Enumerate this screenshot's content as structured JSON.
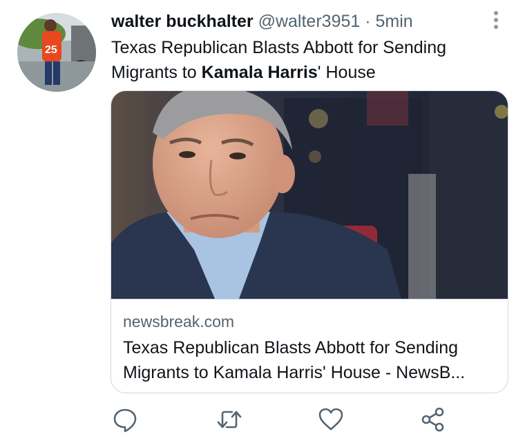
{
  "tweet": {
    "author_name": "walter buckhalter",
    "handle": "@walter3951",
    "separator": "·",
    "time": "5min",
    "text_before": "Texas Republican Blasts Abbott for Sending Migrants to ",
    "text_bold": "Kamala Harris",
    "text_after": "' House"
  },
  "card": {
    "domain": "newsbreak.com",
    "title": "Texas Republican Blasts Abbott for Sending\nMigrants to Kamala Harris' House - NewsB..."
  },
  "icons": {
    "more": "more-vertical-icon",
    "reply": "reply-icon",
    "retweet": "retweet-icon",
    "like": "like-icon",
    "share": "share-icon"
  },
  "colors": {
    "text": "#0f1419",
    "secondary": "#536471",
    "border": "#cfd9de",
    "icon": "#536471"
  }
}
